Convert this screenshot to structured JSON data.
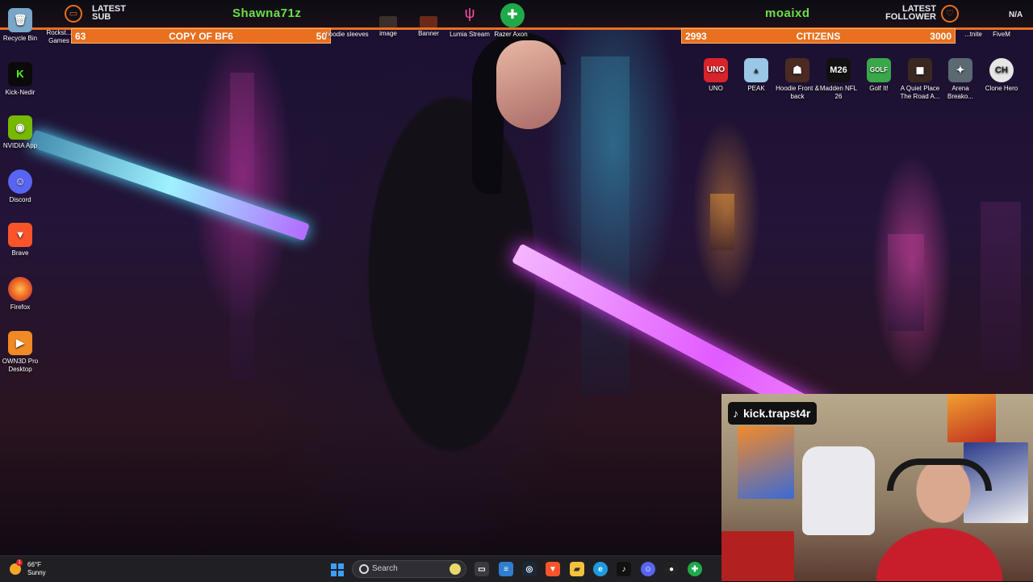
{
  "overlay": {
    "latest_sub_label": "LATEST SUB",
    "latest_sub_name": "Shawna71z",
    "latest_follower_label": "LATEST FOLLOWER",
    "latest_follower_name": "moaixd",
    "na_label": "N/A",
    "goal_left": {
      "start": "63",
      "title": "COPY OF BF6",
      "end": "50"
    },
    "goal_right": {
      "start": "2993",
      "title": "CITIZENS",
      "end": "3000"
    },
    "colors": {
      "accent": "#e8701f",
      "name_green": "#6be04a"
    }
  },
  "desktop": {
    "left_icons": [
      {
        "label": "Recycle Bin",
        "icon": "recycle-bin-icon"
      },
      {
        "label": "Kick-Nedir",
        "icon": "kick-icon"
      },
      {
        "label": "NVIDIA App",
        "icon": "nvidia-icon"
      },
      {
        "label": "Discord",
        "icon": "discord-icon"
      },
      {
        "label": "Brave",
        "icon": "brave-icon"
      },
      {
        "label": "Firefox",
        "icon": "firefox-icon"
      },
      {
        "label": "OWN3D Pro Desktop",
        "icon": "own3d-icon"
      }
    ],
    "top_icons": [
      {
        "label": "Rockst... Games",
        "icon": "rockstar-icon"
      },
      {
        "label": "hoodie sleeves",
        "icon": "image-file-icon"
      },
      {
        "label": "image",
        "icon": "image-file-icon"
      },
      {
        "label": "Banner",
        "icon": "image-file-icon"
      },
      {
        "label": "Lumia Stream",
        "icon": "lumia-icon"
      },
      {
        "label": "Razer Axon",
        "icon": "razer-axon-icon"
      }
    ],
    "top_right_partial": [
      {
        "label": "...tnite",
        "icon": "fortnite-icon"
      },
      {
        "label": "FiveM",
        "icon": "fivem-icon"
      }
    ],
    "right_icons": [
      {
        "label": "UNO",
        "icon": "uno-icon"
      },
      {
        "label": "PEAK",
        "icon": "peak-icon"
      },
      {
        "label": "Hoodie Front & back",
        "icon": "image-file-icon"
      },
      {
        "label": "Madden NFL 26",
        "icon": "madden-icon"
      },
      {
        "label": "Golf It!",
        "icon": "golf-it-icon"
      },
      {
        "label": "A Quiet Place The Road A...",
        "icon": "quiet-place-icon"
      },
      {
        "label": "Arena Breako...",
        "icon": "arena-breakout-icon"
      },
      {
        "label": "Clone Hero",
        "icon": "clone-hero-icon"
      }
    ]
  },
  "webcam": {
    "handle": "kick.trapst4r",
    "handle_icon": "tiktok-icon"
  },
  "taskbar": {
    "weather_temp": "66°F",
    "weather_desc": "Sunny",
    "weather_badge": "1",
    "search_placeholder": "Search",
    "apps": [
      {
        "name": "task-view-icon"
      },
      {
        "name": "notepad-icon"
      },
      {
        "name": "steam-icon"
      },
      {
        "name": "brave-icon"
      },
      {
        "name": "file-explorer-icon"
      },
      {
        "name": "edge-icon"
      },
      {
        "name": "tiktok-icon"
      },
      {
        "name": "discord-icon"
      },
      {
        "name": "obs-icon"
      },
      {
        "name": "razer-axon-icon"
      }
    ]
  }
}
